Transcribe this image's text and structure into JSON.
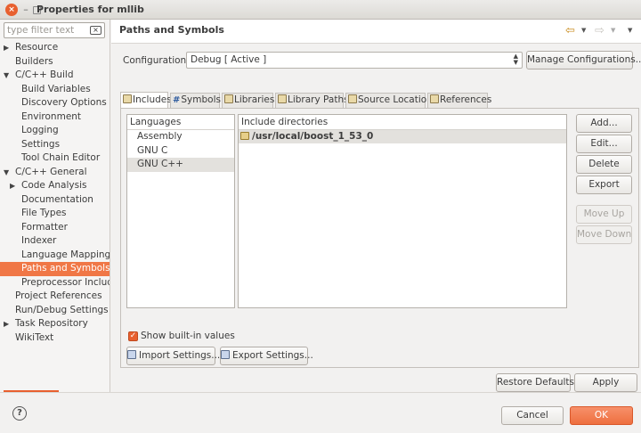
{
  "window": {
    "title": "Properties for mllib"
  },
  "sidebar": {
    "filter_placeholder": "type filter text",
    "items": [
      {
        "label": "Resource",
        "arrow": "▶",
        "level": 0
      },
      {
        "label": "Builders",
        "arrow": "",
        "level": 0
      },
      {
        "label": "C/C++ Build",
        "arrow": "▼",
        "level": 0
      },
      {
        "label": "Build Variables",
        "arrow": "",
        "level": 1
      },
      {
        "label": "Discovery Options",
        "arrow": "",
        "level": 1
      },
      {
        "label": "Environment",
        "arrow": "",
        "level": 1
      },
      {
        "label": "Logging",
        "arrow": "",
        "level": 1
      },
      {
        "label": "Settings",
        "arrow": "",
        "level": 1
      },
      {
        "label": "Tool Chain Editor",
        "arrow": "",
        "level": 1
      },
      {
        "label": "C/C++ General",
        "arrow": "▼",
        "level": 0
      },
      {
        "label": "Code Analysis",
        "arrow": "▶",
        "level": 1
      },
      {
        "label": "Documentation",
        "arrow": "",
        "level": 1
      },
      {
        "label": "File Types",
        "arrow": "",
        "level": 1
      },
      {
        "label": "Formatter",
        "arrow": "",
        "level": 1
      },
      {
        "label": "Indexer",
        "arrow": "",
        "level": 1
      },
      {
        "label": "Language Mappings",
        "arrow": "",
        "level": 1
      },
      {
        "label": "Paths and Symbols",
        "arrow": "",
        "level": 1,
        "selected": true
      },
      {
        "label": "Preprocessor Include",
        "arrow": "",
        "level": 1
      },
      {
        "label": "Project References",
        "arrow": "",
        "level": 0
      },
      {
        "label": "Run/Debug Settings",
        "arrow": "",
        "level": 0
      },
      {
        "label": "Task Repository",
        "arrow": "▶",
        "level": 0
      },
      {
        "label": "WikiText",
        "arrow": "",
        "level": 0
      }
    ]
  },
  "page": {
    "title": "Paths and Symbols",
    "configuration_label": "Configuration:",
    "configuration_value": "Debug  [ Active ]",
    "manage_label": "Manage Configurations..."
  },
  "tabs": [
    {
      "label": "Includes",
      "icon": "folder",
      "active": true
    },
    {
      "label": "Symbols",
      "icon": "hash",
      "active": false
    },
    {
      "label": "Libraries",
      "icon": "library",
      "active": false
    },
    {
      "label": "Library Paths",
      "icon": "folder",
      "active": false
    },
    {
      "label": "Source Location",
      "icon": "folder",
      "active": false
    },
    {
      "label": "References",
      "icon": "doc",
      "active": false
    }
  ],
  "languages": {
    "header": "Languages",
    "items": [
      "Assembly",
      "GNU C",
      "GNU C++"
    ],
    "selected": "GNU C++"
  },
  "includes": {
    "header": "Include directories",
    "items": [
      "/usr/local/boost_1_53_0"
    ]
  },
  "side_buttons": {
    "add": "Add...",
    "edit": "Edit...",
    "delete": "Delete",
    "export": "Export",
    "move_up": "Move Up",
    "move_down": "Move Down"
  },
  "show_builtin": {
    "label": "Show built-in values",
    "checked": true
  },
  "import_settings": "Import Settings...",
  "export_settings": "Export Settings...",
  "restore_defaults": "Restore Defaults",
  "apply": "Apply",
  "cancel": "Cancel",
  "ok": "OK",
  "colors": {
    "accent": "#f07746",
    "selection": "#e3e1dd"
  }
}
